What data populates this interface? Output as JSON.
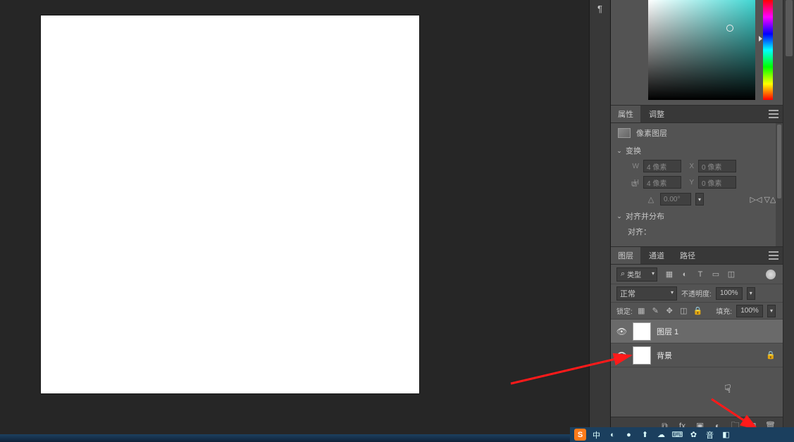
{
  "dock": {
    "paragraph_icon": "¶"
  },
  "color_panel": {
    "cursor_x_pct": 76,
    "cursor_y_pct": 28,
    "hue_arrow_pct": 37
  },
  "properties_panel": {
    "tabs": {
      "properties": "属性",
      "adjustments": "调整"
    },
    "type_label": "像素图层",
    "sections": {
      "transform": "变换",
      "align": "对齐并分布",
      "align_lbl": "对齐："
    },
    "w_label": "W",
    "h_label": "H",
    "x_label": "X",
    "y_label": "Y",
    "w_value": "4 像素",
    "h_value": "4 像素",
    "x_value": "0 像素",
    "y_value": "0 像素",
    "angle_icon": "△",
    "angle_value": "0.00°"
  },
  "layers_panel": {
    "tabs": {
      "layers": "图层",
      "channels": "通道",
      "paths": "路径"
    },
    "filter_label": "类型",
    "blend_mode": "正常",
    "opacity_label": "不透明度:",
    "opacity_value": "100%",
    "lock_label": "锁定:",
    "fill_label": "填充:",
    "fill_value": "100%",
    "layers": [
      {
        "name": "图层 1",
        "visible": true,
        "locked": false,
        "selected": true
      },
      {
        "name": "背景",
        "visible": true,
        "locked": true,
        "selected": false
      }
    ]
  },
  "taskbar_tray": {
    "items": [
      "S",
      "中",
      "◐",
      "●",
      "⬆",
      "☁",
      "⌨",
      "✿",
      "音",
      "◧"
    ]
  }
}
